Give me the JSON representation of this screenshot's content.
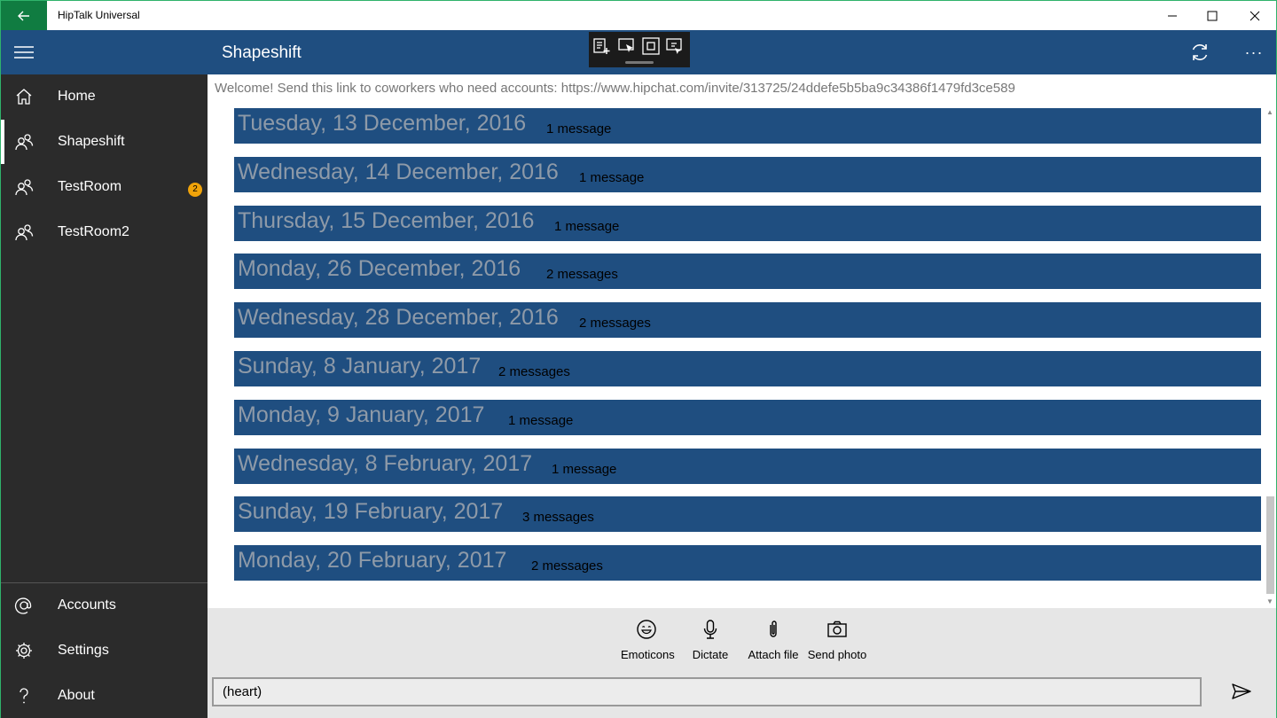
{
  "window": {
    "title": "HipTalk Universal"
  },
  "header": {
    "room_title": "Shapeshift",
    "more_label": "···"
  },
  "sidebar": {
    "items": [
      {
        "label": "Home",
        "icon": "home-icon"
      },
      {
        "label": "Shapeshift",
        "icon": "people-icon",
        "active": true
      },
      {
        "label": "TestRoom",
        "icon": "people-icon",
        "badge": "2"
      },
      {
        "label": "TestRoom2",
        "icon": "people-icon"
      }
    ],
    "bottom_items": [
      {
        "label": "Accounts",
        "icon": "at-icon"
      },
      {
        "label": "Settings",
        "icon": "gear-icon"
      },
      {
        "label": "About",
        "icon": "question-icon"
      }
    ]
  },
  "content": {
    "welcome": "Welcome! Send this link to coworkers who need accounts: https://www.hipchat.com/invite/313725/24ddefe5b5ba9c34386f1479fd3ce589",
    "dates": [
      {
        "date": "Tuesday, 13 December, 2016",
        "count": "1 message"
      },
      {
        "date": "Wednesday, 14 December, 2016",
        "count": "1 message"
      },
      {
        "date": "Thursday, 15 December, 2016",
        "count": "1 message"
      },
      {
        "date": "Monday, 26 December, 2016",
        "count": "2 messages"
      },
      {
        "date": "Wednesday, 28 December, 2016",
        "count": "2 messages"
      },
      {
        "date": "Sunday, 8 January, 2017",
        "count": "2 messages"
      },
      {
        "date": "Monday, 9 January, 2017",
        "count": "1 message"
      },
      {
        "date": "Wednesday, 8 February, 2017",
        "count": "1 message"
      },
      {
        "date": "Sunday, 19 February, 2017",
        "count": "3 messages"
      },
      {
        "date": "Monday, 20 February, 2017",
        "count": "2 messages"
      }
    ]
  },
  "composer": {
    "tools": [
      {
        "label": "Emoticons",
        "icon": "smiley-icon"
      },
      {
        "label": "Dictate",
        "icon": "microphone-icon"
      },
      {
        "label": "Attach file",
        "icon": "paperclip-icon"
      },
      {
        "label": "Send photo",
        "icon": "camera-icon"
      }
    ],
    "input_value": "(heart)"
  },
  "colors": {
    "accent": "#1f4e80",
    "titlebar_back": "#107c41",
    "sidebar_bg": "#2b2b2b",
    "badge": "#f0a30a"
  }
}
